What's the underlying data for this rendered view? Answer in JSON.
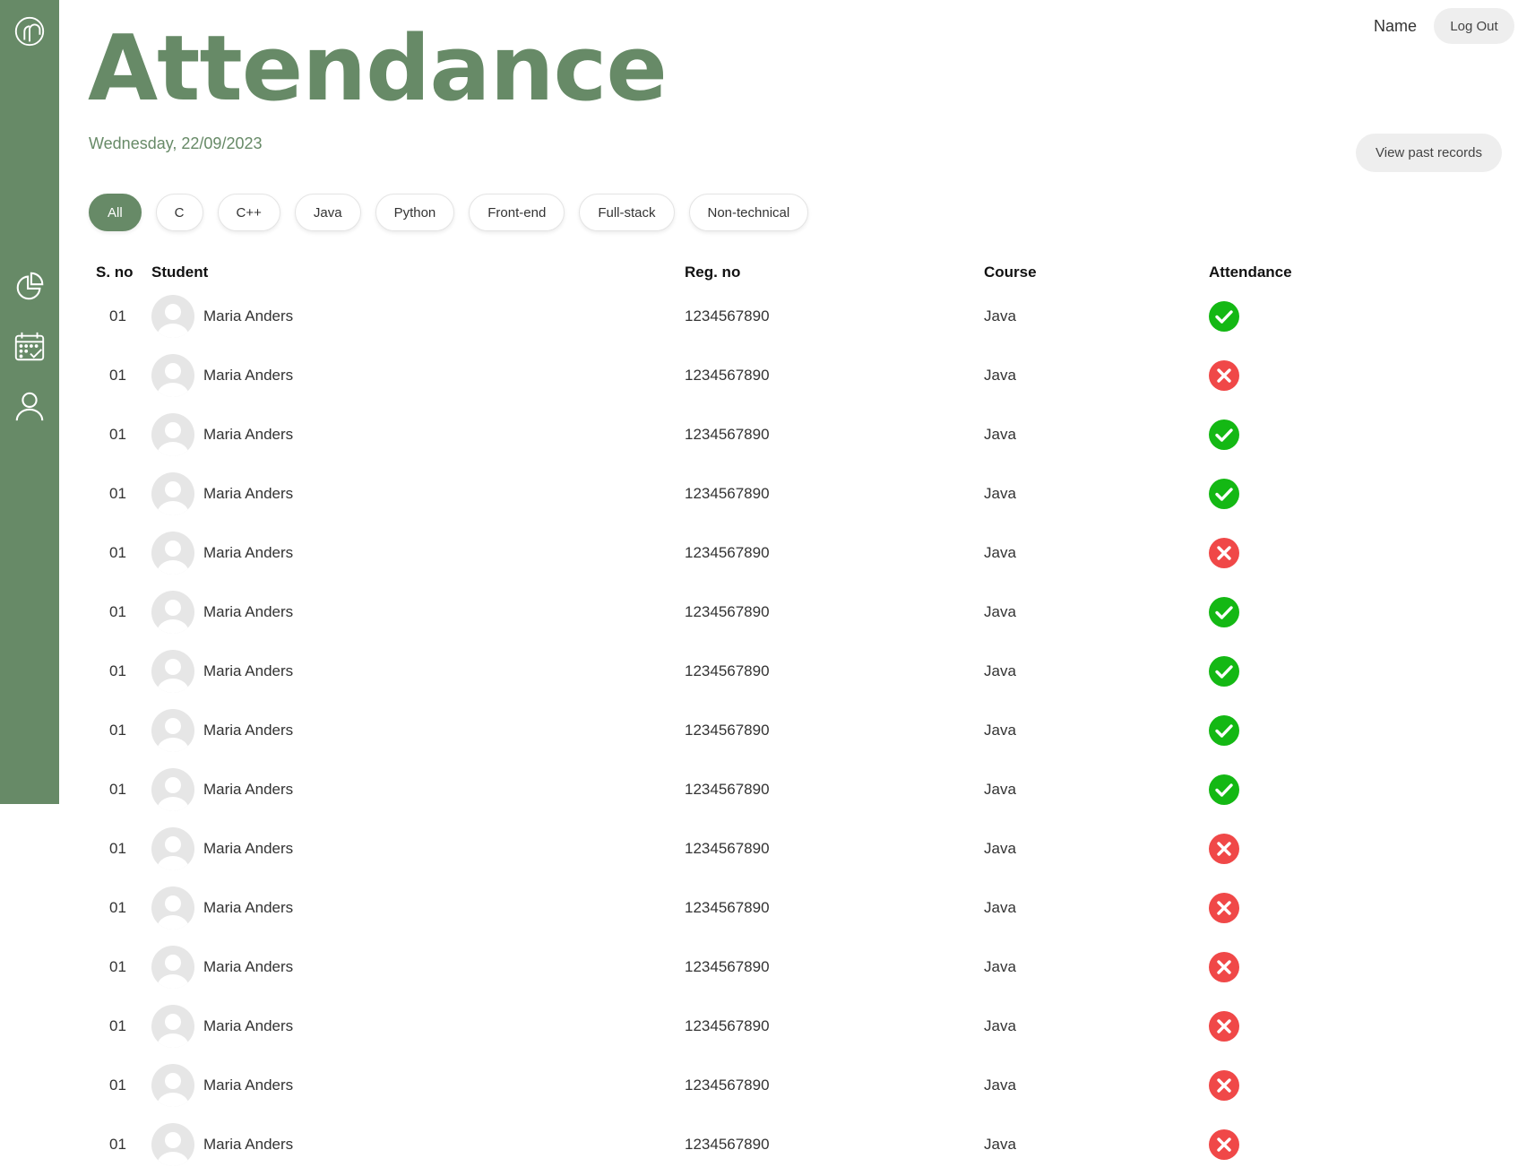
{
  "sidebar": {
    "icons": [
      "logo-icon",
      "pie-chart-icon",
      "calendar-check-icon",
      "user-icon"
    ]
  },
  "header": {
    "title": "Attendance",
    "date": "Wednesday, 22/09/2023",
    "user_name": "Name",
    "logout_label": "Log Out",
    "past_records_label": "View past records"
  },
  "filters": [
    "All",
    "C",
    "C++",
    "Java",
    "Python",
    "Front-end",
    "Full-stack",
    "Non-technical"
  ],
  "active_filter": "All",
  "table": {
    "columns": {
      "sno": "S. no",
      "student": "Student",
      "reg": "Reg. no",
      "course": "Course",
      "attendance": "Attendance"
    },
    "rows": [
      {
        "sno": "01",
        "name": "Maria Anders",
        "reg": "1234567890",
        "course": "Java",
        "present": true
      },
      {
        "sno": "01",
        "name": "Maria Anders",
        "reg": "1234567890",
        "course": "Java",
        "present": false
      },
      {
        "sno": "01",
        "name": "Maria Anders",
        "reg": "1234567890",
        "course": "Java",
        "present": true
      },
      {
        "sno": "01",
        "name": "Maria Anders",
        "reg": "1234567890",
        "course": "Java",
        "present": true
      },
      {
        "sno": "01",
        "name": "Maria Anders",
        "reg": "1234567890",
        "course": "Java",
        "present": false
      },
      {
        "sno": "01",
        "name": "Maria Anders",
        "reg": "1234567890",
        "course": "Java",
        "present": true
      },
      {
        "sno": "01",
        "name": "Maria Anders",
        "reg": "1234567890",
        "course": "Java",
        "present": true
      },
      {
        "sno": "01",
        "name": "Maria Anders",
        "reg": "1234567890",
        "course": "Java",
        "present": true
      },
      {
        "sno": "01",
        "name": "Maria Anders",
        "reg": "1234567890",
        "course": "Java",
        "present": true
      },
      {
        "sno": "01",
        "name": "Maria Anders",
        "reg": "1234567890",
        "course": "Java",
        "present": false
      },
      {
        "sno": "01",
        "name": "Maria Anders",
        "reg": "1234567890",
        "course": "Java",
        "present": false
      },
      {
        "sno": "01",
        "name": "Maria Anders",
        "reg": "1234567890",
        "course": "Java",
        "present": false
      },
      {
        "sno": "01",
        "name": "Maria Anders",
        "reg": "1234567890",
        "course": "Java",
        "present": false
      },
      {
        "sno": "01",
        "name": "Maria Anders",
        "reg": "1234567890",
        "course": "Java",
        "present": false
      },
      {
        "sno": "01",
        "name": "Maria Anders",
        "reg": "1234567890",
        "course": "Java",
        "present": false
      }
    ]
  },
  "colors": {
    "brand": "#678a67",
    "present": "#14b814",
    "absent": "#f04848"
  }
}
